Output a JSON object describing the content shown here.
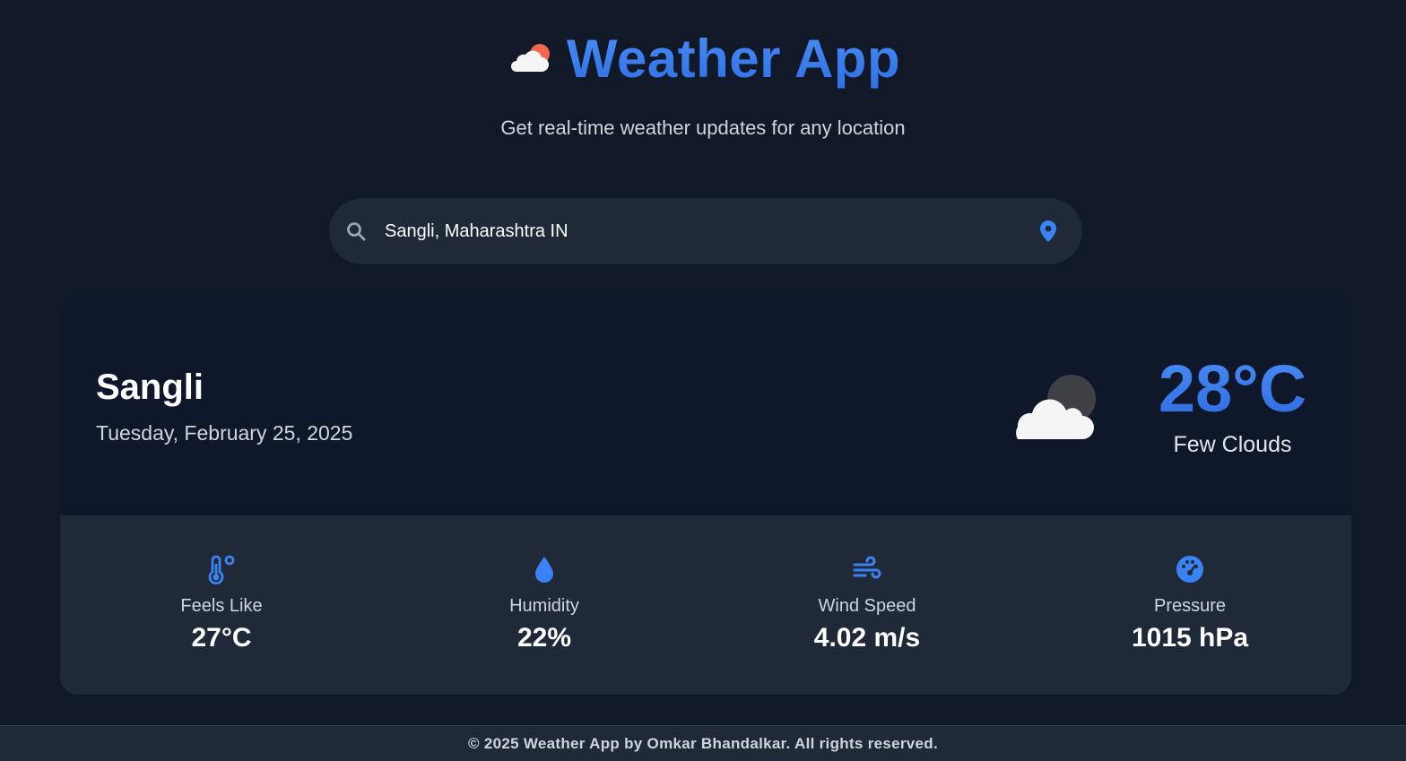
{
  "header": {
    "title": "Weather App",
    "subtitle": "Get real-time weather updates for any location",
    "logo_icon": "cloud-sun-icon"
  },
  "search": {
    "value": "Sangli, Maharashtra IN",
    "placeholder": "",
    "search_icon": "search-icon",
    "location_icon": "location-pin-icon"
  },
  "current": {
    "city": "Sangli",
    "date": "Tuesday, February 25, 2025",
    "temperature": "28°C",
    "condition": "Few Clouds",
    "icon": "cloud-moon-icon"
  },
  "stats": [
    {
      "icon": "thermometer-icon",
      "label": "Feels Like",
      "value": "27°C"
    },
    {
      "icon": "droplet-icon",
      "label": "Humidity",
      "value": "22%"
    },
    {
      "icon": "wind-icon",
      "label": "Wind Speed",
      "value": "4.02 m/s"
    },
    {
      "icon": "gauge-icon",
      "label": "Pressure",
      "value": "1015 hPa"
    }
  ],
  "footer": {
    "text": "© 2025 Weather App by Omkar Bhandalkar. All rights reserved."
  },
  "colors": {
    "background": "#111827",
    "accent": "#3b82f6",
    "panel": "#1f2937",
    "card": "#0f172a"
  }
}
